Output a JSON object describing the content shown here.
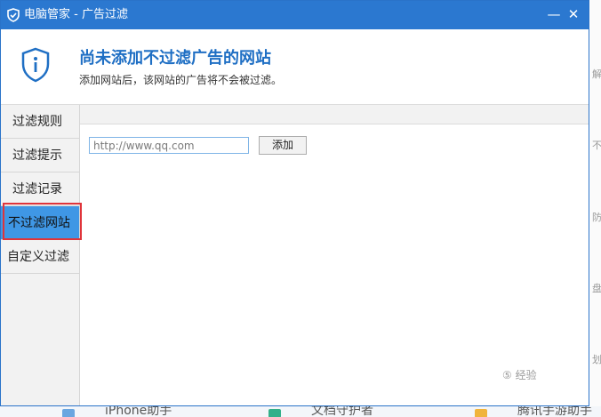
{
  "window": {
    "title": "电脑管家 - 广告过滤",
    "minimize": "—",
    "close": "✕"
  },
  "header": {
    "title": "尚未添加不过滤广告的网站",
    "subtitle": "添加网站后，该网站的广告将不会被过滤。",
    "icon": "info-shield-icon"
  },
  "sidebar": {
    "items": [
      {
        "label": "过滤规则"
      },
      {
        "label": "过滤提示"
      },
      {
        "label": "过滤记录"
      },
      {
        "label": "不过滤网站"
      },
      {
        "label": "自定义过滤"
      }
    ],
    "active_index": 3
  },
  "main": {
    "url_placeholder": "http://www.qq.com",
    "add_button": "添加"
  },
  "background": {
    "right_fragments": [
      "解",
      "不",
      "防",
      "盘",
      "划"
    ],
    "taskbar": [
      "iPhone助手",
      "文档守护者",
      "腾讯手游助手"
    ]
  },
  "watermark": "⑤ 经验",
  "colors": {
    "titlebar": "#2b78d0",
    "accent_blue": "#1f6fc4",
    "active_tab": "#3f97e5",
    "highlight_red": "#e0343a"
  }
}
